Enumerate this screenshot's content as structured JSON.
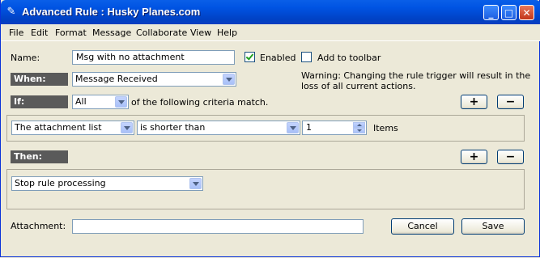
{
  "window": {
    "title": "Advanced Rule : Husky Planes.com",
    "icon": "app-icon"
  },
  "menu": [
    "File",
    "Edit",
    "Format",
    "Message",
    "Collaborate",
    "View",
    "Help"
  ],
  "form": {
    "name_label": "Name:",
    "name_value": "Msg with no attachment",
    "enabled_label": "Enabled",
    "enabled_checked": true,
    "toolbar_label": "Add to toolbar",
    "toolbar_checked": false,
    "when_label": "When:",
    "when_value": "Message Received",
    "warning": "Warning:  Changing the rule trigger will result in the",
    "warning2": "loss of all current actions.",
    "if_label": "If:",
    "if_match": "All",
    "criteria_text": "of the following criteria match.",
    "criteria": {
      "field": "The attachment list",
      "operator": "is shorter than",
      "value": "1",
      "unit": "Items"
    },
    "then_label": "Then:",
    "action": "Stop rule processing",
    "attachment_label": "Attachment:",
    "attachment_value": "",
    "plus": "+",
    "minus": "−",
    "cancel": "Cancel",
    "save": "Save"
  },
  "colors": {
    "titlebar": "#0054e3",
    "section_header": "#5a5a5a",
    "window_bg": "#ece9d8"
  }
}
